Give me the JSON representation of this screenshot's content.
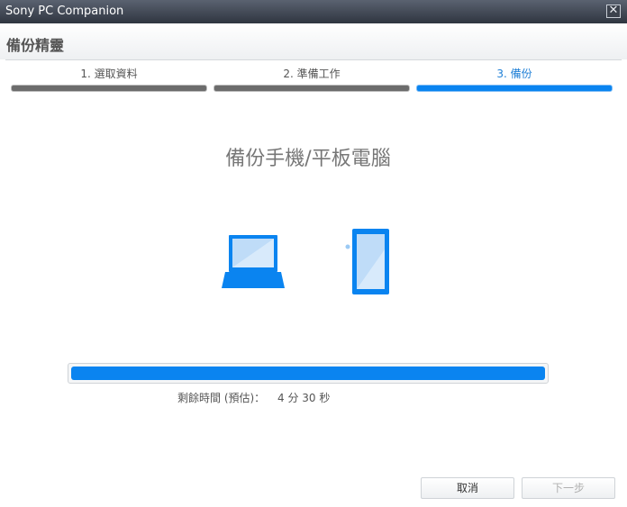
{
  "window": {
    "title": "Sony PC Companion",
    "close_glyph": "✕"
  },
  "header": {
    "title": "備份精靈"
  },
  "steps": [
    {
      "label": "1. 選取資料",
      "state": "done"
    },
    {
      "label": "2. 準備工作",
      "state": "done"
    },
    {
      "label": "3. 備份",
      "state": "active"
    }
  ],
  "main": {
    "heading": "備份手機/平板電腦",
    "icons": [
      "laptop-icon",
      "tablet-icon"
    ]
  },
  "progress": {
    "percent": 100,
    "remaining_label": "剩餘時間 (預估)：",
    "remaining_value": "4 分 30 秒"
  },
  "buttons": {
    "cancel_label": "取消",
    "next_label": "下一步"
  },
  "colors": {
    "accent": "#0a84f0",
    "step_done": "#6c6c6c",
    "titlebar": "#3c424d"
  }
}
